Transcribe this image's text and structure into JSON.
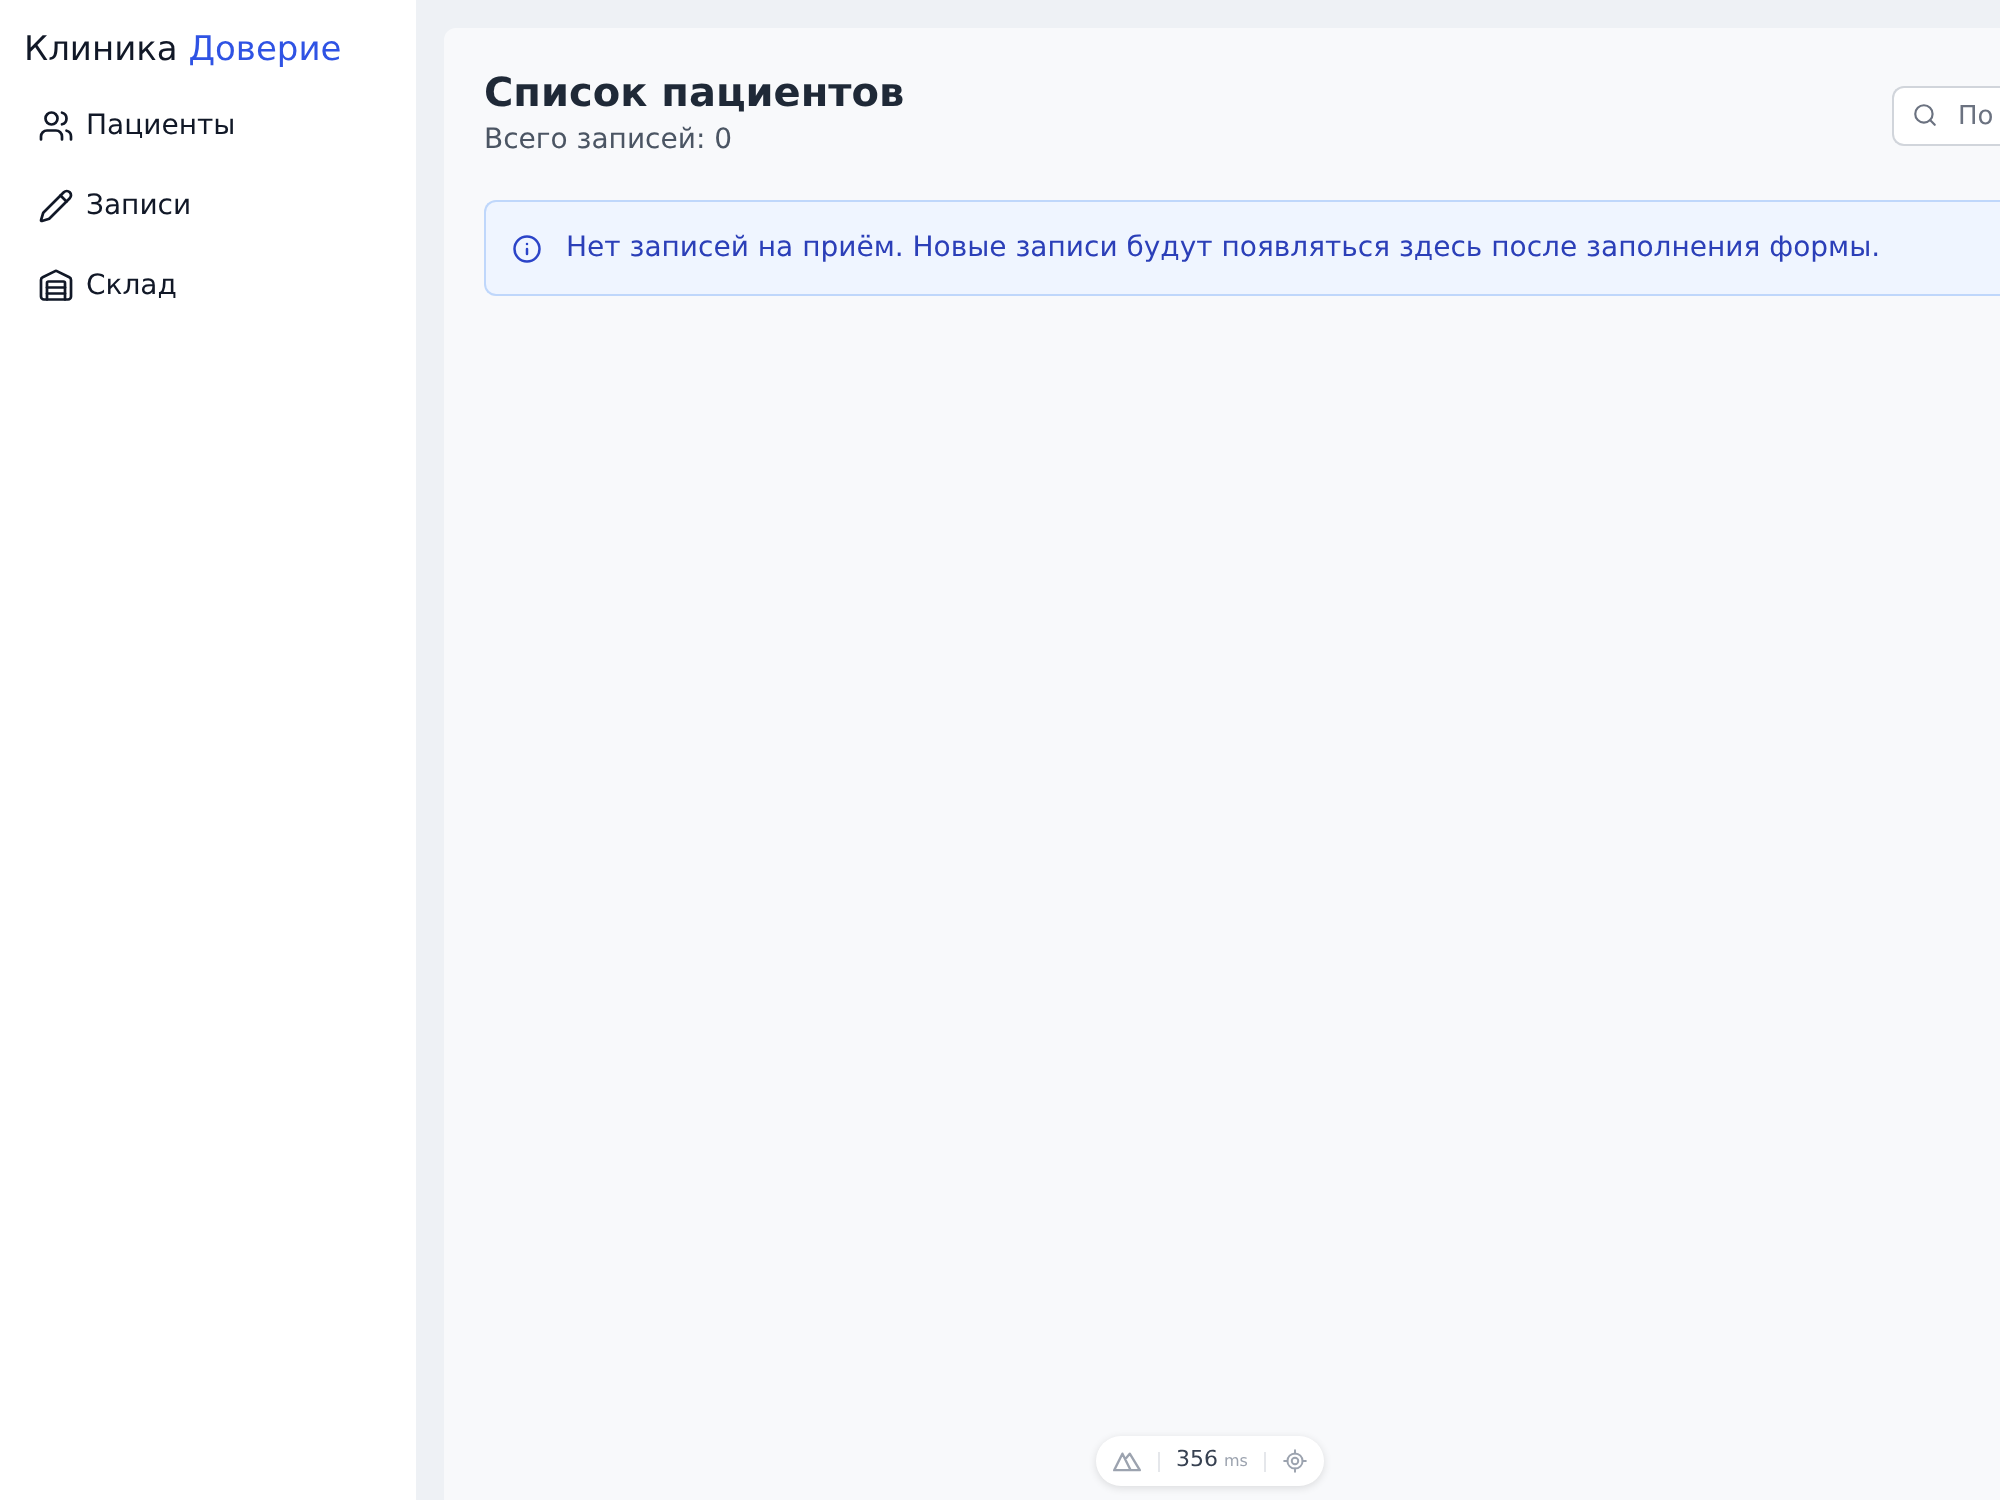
{
  "sidebar": {
    "brand": {
      "name": "Клиника",
      "accent": "Доверие"
    },
    "items": [
      {
        "label": "Пациенты"
      },
      {
        "label": "Записи"
      },
      {
        "label": "Склад"
      }
    ]
  },
  "header": {
    "title": "Список пациентов",
    "subtitle": "Всего записей: 0",
    "search": {
      "placeholder": "По"
    }
  },
  "alert": {
    "kind": "info",
    "text": "Нет записей на приём. Новые записи будут появляться здесь после заполнения формы."
  },
  "dev_toolbar": {
    "time": "356",
    "unit": "ms"
  }
}
